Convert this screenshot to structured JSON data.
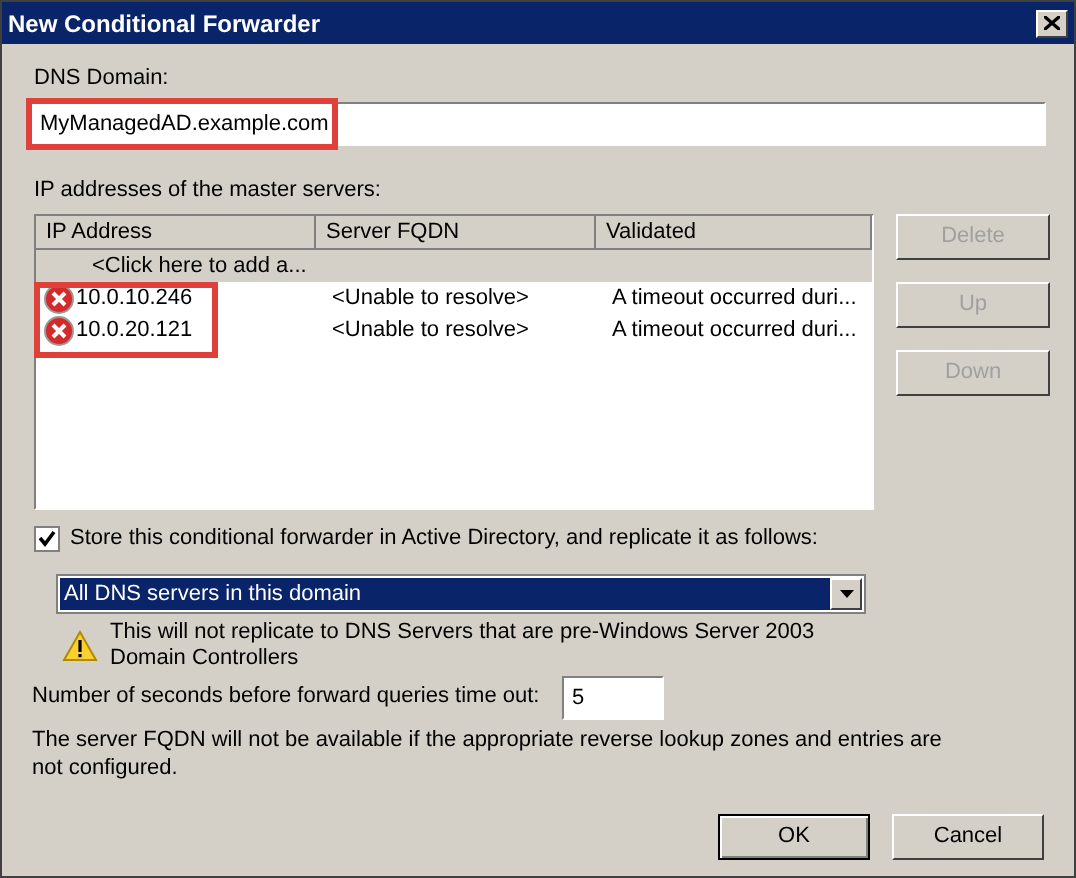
{
  "window": {
    "title": "New Conditional Forwarder"
  },
  "dns_domain": {
    "label": "DNS Domain:",
    "value": "MyManagedAD.example.com",
    "highlighted": true
  },
  "master_servers": {
    "label": "IP addresses of the master servers:",
    "columns": [
      "IP Address",
      "Server FQDN",
      "Validated"
    ],
    "rows": [
      {
        "kind": "add",
        "selected": true,
        "cells": [
          "<Click here to add a..."
        ]
      },
      {
        "kind": "server",
        "selected": false,
        "error": true,
        "cells": [
          "10.0.10.246",
          "<Unable to resolve>",
          "A timeout occurred duri..."
        ]
      },
      {
        "kind": "server",
        "selected": false,
        "error": true,
        "cells": [
          "10.0.20.121",
          "<Unable to resolve>",
          "A timeout occurred duri..."
        ]
      }
    ],
    "highlight_rows": true,
    "buttons": [
      {
        "label": "Delete",
        "disabled": true
      },
      {
        "label": "Up",
        "disabled": true
      },
      {
        "label": "Down",
        "disabled": true
      }
    ]
  },
  "store_in_ad": {
    "label": "Store this conditional forwarder in Active Directory, and replicate it as follows:",
    "checked": true
  },
  "replication": {
    "value": "All DNS servers in this domain"
  },
  "warning": "This will not replicate to DNS Servers that are pre-Windows Server 2003 Domain Controllers",
  "timeout": {
    "label": "Number of seconds before forward queries time out:",
    "value": "5"
  },
  "note": "The server FQDN will not be available if the appropriate reverse lookup zones and entries are not configured.",
  "dialog_buttons": [
    "OK",
    "Cancel"
  ]
}
